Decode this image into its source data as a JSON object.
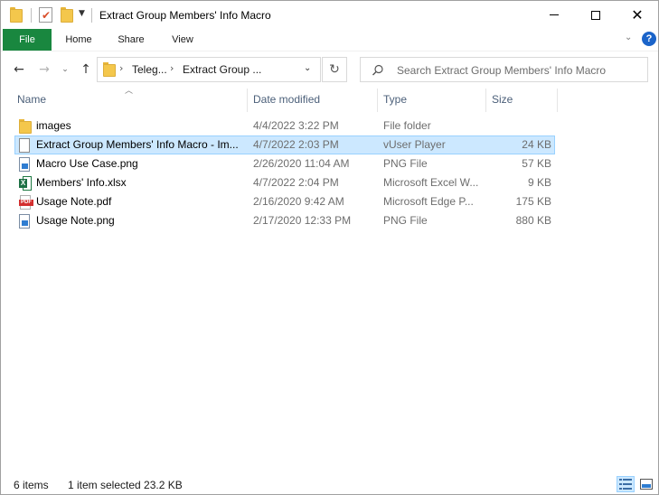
{
  "window": {
    "title": "Extract Group Members' Info Macro"
  },
  "ribbon": {
    "tabs": [
      {
        "label": "File"
      },
      {
        "label": "Home"
      },
      {
        "label": "Share"
      },
      {
        "label": "View"
      }
    ],
    "help_label": "?"
  },
  "navigation": {
    "breadcrumbs": [
      "Teleg...",
      "Extract Group ..."
    ],
    "search_placeholder": "Search Extract Group Members' Info Macro"
  },
  "file_list": {
    "sort_column": "Name",
    "columns": [
      {
        "label": "Name"
      },
      {
        "label": "Date modified"
      },
      {
        "label": "Type"
      },
      {
        "label": "Size"
      }
    ],
    "rows": [
      {
        "icon": "folder-icon",
        "name": "images",
        "date": "4/4/2022 3:22 PM",
        "type": "File folder",
        "size": "",
        "selected": false
      },
      {
        "icon": "document-icon",
        "name": "Extract Group Members' Info Macro - Im...",
        "date": "4/7/2022 2:03 PM",
        "type": "vUser Player",
        "size": "24 KB",
        "selected": true
      },
      {
        "icon": "png-image-icon",
        "name": "Macro Use Case.png",
        "date": "2/26/2020 11:04 AM",
        "type": "PNG File",
        "size": "57 KB",
        "selected": false
      },
      {
        "icon": "excel-icon",
        "name": "Members' Info.xlsx",
        "date": "4/7/2022 2:04 PM",
        "type": "Microsoft Excel W...",
        "size": "9 KB",
        "selected": false
      },
      {
        "icon": "pdf-icon",
        "name": "Usage Note.pdf",
        "date": "2/16/2020 9:42 AM",
        "type": "Microsoft Edge P...",
        "size": "175 KB",
        "selected": false
      },
      {
        "icon": "png-image-icon",
        "name": "Usage Note.png",
        "date": "2/17/2020 12:33 PM",
        "type": "PNG File",
        "size": "880 KB",
        "selected": false
      }
    ]
  },
  "status_bar": {
    "item_count": "6 items",
    "selection": "1 item selected  23.2 KB"
  },
  "colors": {
    "file_tab": "#19873f",
    "selection_bg": "#cce8ff",
    "selection_border": "#99d1ff",
    "folder": "#f4c74c",
    "header_text": "#4c607a"
  }
}
